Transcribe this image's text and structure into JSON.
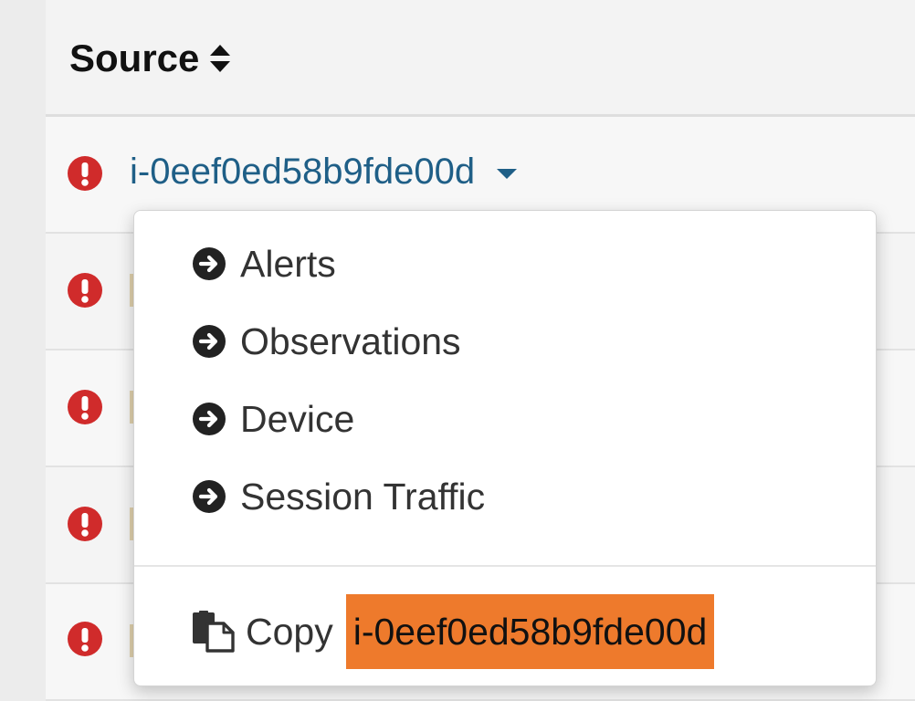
{
  "table": {
    "column_header": "Source",
    "first_row_source": "i-0eef0ed58b9fde00d"
  },
  "dropdown": {
    "items": [
      {
        "label": "Alerts",
        "icon": "arrow-circle-right-icon"
      },
      {
        "label": "Observations",
        "icon": "arrow-circle-right-icon"
      },
      {
        "label": "Device",
        "icon": "arrow-circle-right-icon"
      },
      {
        "label": "Session Traffic",
        "icon": "arrow-circle-right-icon"
      }
    ],
    "copy_label": "Copy",
    "copy_value": "i-0eef0ed58b9fde00d"
  },
  "colors": {
    "link": "#1f5f87",
    "alert": "#d02b2b",
    "highlight": "#ee7a2c"
  }
}
